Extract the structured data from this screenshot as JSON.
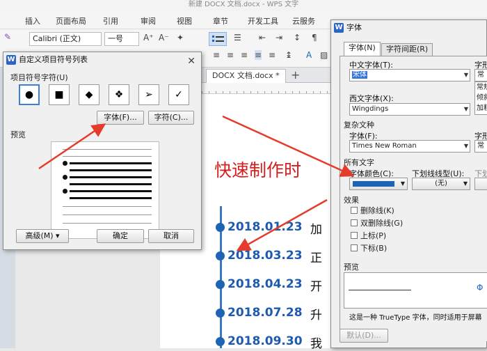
{
  "window": {
    "title": "新建 DOCX 文档.docx - WPS 文字"
  },
  "ribbon": {
    "tabs": [
      "插入",
      "页面布局",
      "引用",
      "审阅",
      "视图",
      "章节",
      "开发工具",
      "云服务"
    ]
  },
  "toolbar": {
    "font_name": "Calibri (正文)",
    "font_size": "一号"
  },
  "document": {
    "tab_label": "DOCX 文档.docx *",
    "title": "快速制作时",
    "timeline": [
      {
        "date": "2018.01.23",
        "text": "加"
      },
      {
        "date": "2018.03.23",
        "text": "正"
      },
      {
        "date": "2018.04.23",
        "text": "开"
      },
      {
        "date": "2018.07.28",
        "text": "升"
      },
      {
        "date": "2018.09.30",
        "text": "我"
      }
    ]
  },
  "bullet_dialog": {
    "title": "自定义项目符号列表",
    "symbols_label": "项目符号字符(U)",
    "symbols": [
      "●",
      "■",
      "◆",
      "❖",
      "➢",
      "✓"
    ],
    "font_button": "字体(F)...",
    "char_button": "字符(C)...",
    "preview_label": "预览",
    "advanced_button": "高级(M) ▾",
    "ok_button": "确定",
    "cancel_button": "取消"
  },
  "font_dialog": {
    "title": "字体",
    "tabs": [
      "字体(N)",
      "字符间距(R)"
    ],
    "cn_font_label": "中文字体(T):",
    "cn_font_value": "宋体",
    "style_label": "字形",
    "style_top": "常",
    "style_items": [
      "常规",
      "倾斜",
      "加粗"
    ],
    "west_font_label": "西文字体(X):",
    "west_font_value": "Wingdings",
    "complex_label": "复杂文种",
    "complex_font_label": "字体(F):",
    "complex_font_value": "Times New Roman",
    "complex_style_label": "字形",
    "complex_style_value": "常",
    "all_text_label": "所有文字",
    "color_label": "字体颜色(C):",
    "underline_label": "下划线线型(U):",
    "underline_color_label": "下划",
    "underline_value": "(无)",
    "effects_label": "效果",
    "effects": [
      "删除线(K)",
      "双删除线(G)",
      "上标(P)",
      "下标(B)"
    ],
    "preview_label": "预览",
    "preview_symbol": "Φ",
    "note": "这是一种 TrueType 字体，同时适用于屏幕",
    "default_button": "默认(D)..."
  },
  "colors": {
    "accent": "#2a66c8",
    "font_color": "#1d64b4",
    "title_red": "#d41f1f",
    "arrow_red": "#e53b2c"
  }
}
